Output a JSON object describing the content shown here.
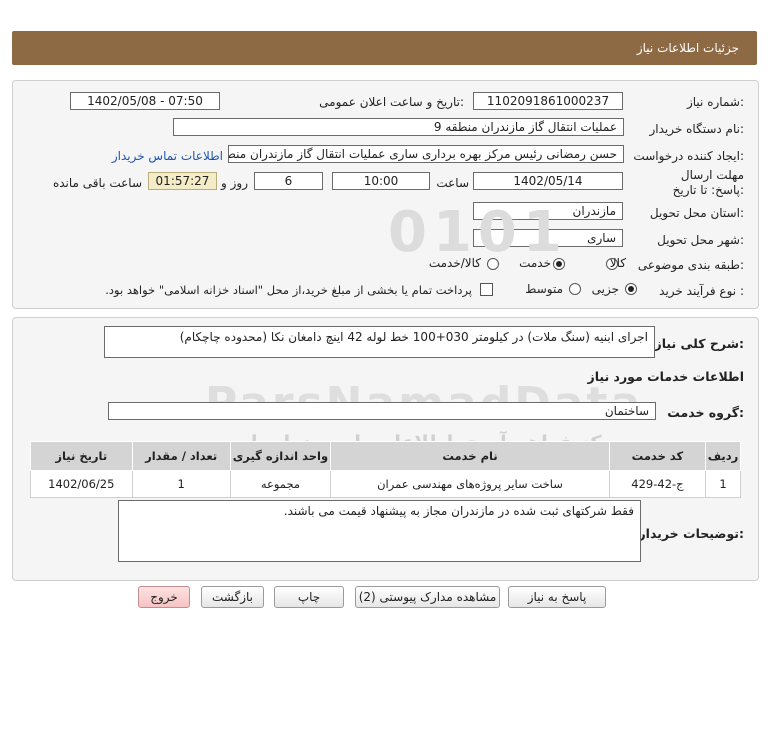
{
  "title": "جزئیات اطلاعات نیاز",
  "fields": {
    "need_number_label": "شماره نیاز:",
    "need_number": "1102091861000237",
    "announce_label": "تاریخ و ساعت اعلان عمومی:",
    "announce_value": "1402/05/08 - 07:50",
    "buyer_org_label": "نام دستگاه خریدار:",
    "buyer_org": "عملیات انتقال گاز مازندران منطقه 9",
    "requester_label": "ایجاد کننده درخواست:",
    "requester": "حسن رمضانی رئیس مرکز بهره برداری ساری عملیات انتقال گاز مازندران منطقه",
    "contact_link": "اطلاعات تماس خریدار",
    "deadline_label": "مهلت ارسال پاسخ: تا تاریخ:",
    "deadline_date": "1402/05/14",
    "time_label": "ساعت",
    "deadline_time": "10:00",
    "days_value": "6",
    "days_label": "روز و",
    "remaining_time": "01:57:27",
    "remaining_label": "ساعت باقی مانده",
    "province_label": "استان محل تحویل:",
    "province": "مازندران",
    "city_label": "شهر محل تحویل:",
    "city": "ساری",
    "category_label": "طبقه بندی موضوعی:",
    "category_options": [
      "کالا",
      "خدمت",
      "کالا/خدمت"
    ],
    "category_selected": "خدمت",
    "purchase_type_label": "نوع فرآیند خرید :",
    "purchase_type_options": [
      "جزیی",
      "متوسط"
    ],
    "purchase_type_selected": "جزیی",
    "payment_note": "پرداخت تمام یا بخشی از مبلغ خرید،از محل \"اسناد خزانه اسلامی\" خواهد بود."
  },
  "description": {
    "label": "شرح کلی نیاز:",
    "value": "اجرای ابنیه (سنگ ملات) در کیلومتر 030+100 خط لوله 42 اینچ دامغان نکا (محدوده چاچکام)"
  },
  "services": {
    "section_title": "اطلاعات خدمات مورد نیاز",
    "group_label": "گروه خدمت:",
    "group_value": "ساختمان",
    "table": {
      "headers": [
        "ردیف",
        "کد خدمت",
        "نام خدمت",
        "واحد اندازه گیری",
        "تعداد / مقدار",
        "تاریخ نیاز"
      ],
      "rows": [
        [
          "1",
          "ج-42-429",
          "ساخت سایر پروژه‌های مهندسی عمران",
          "مجموعه",
          "1",
          "1402/06/25"
        ]
      ]
    }
  },
  "buyer_notes": {
    "label": "توضیحات خریدار:",
    "value": "فقط شرکتهای ثبت شده در مازندران مجاز به پیشنهاد قیمت می باشند."
  },
  "buttons": {
    "reply": "پاسخ به نیاز",
    "attachments": "مشاهده مدارک پیوستی (2)",
    "print": "چاپ",
    "back": "بازگشت",
    "exit": "خروج"
  },
  "watermark": {
    "brand": "ParsNamadData",
    "line1": "مرکز فراهم آوری اطلاعات پارس نماد داده",
    "line2": "پایگاه اطلاع رسانی مناقصه و مزایده",
    "phone": "۰۲۱-۸۸۳۴۹۶۷۰-۵",
    "digits": "0101"
  },
  "colors": {
    "title_bar": "#8e6a44",
    "panel_bg": "#f5f5f5",
    "remaining_bg": "#f3ecc6",
    "exit_button": "#f6c3c3",
    "link": "#2255aa"
  }
}
